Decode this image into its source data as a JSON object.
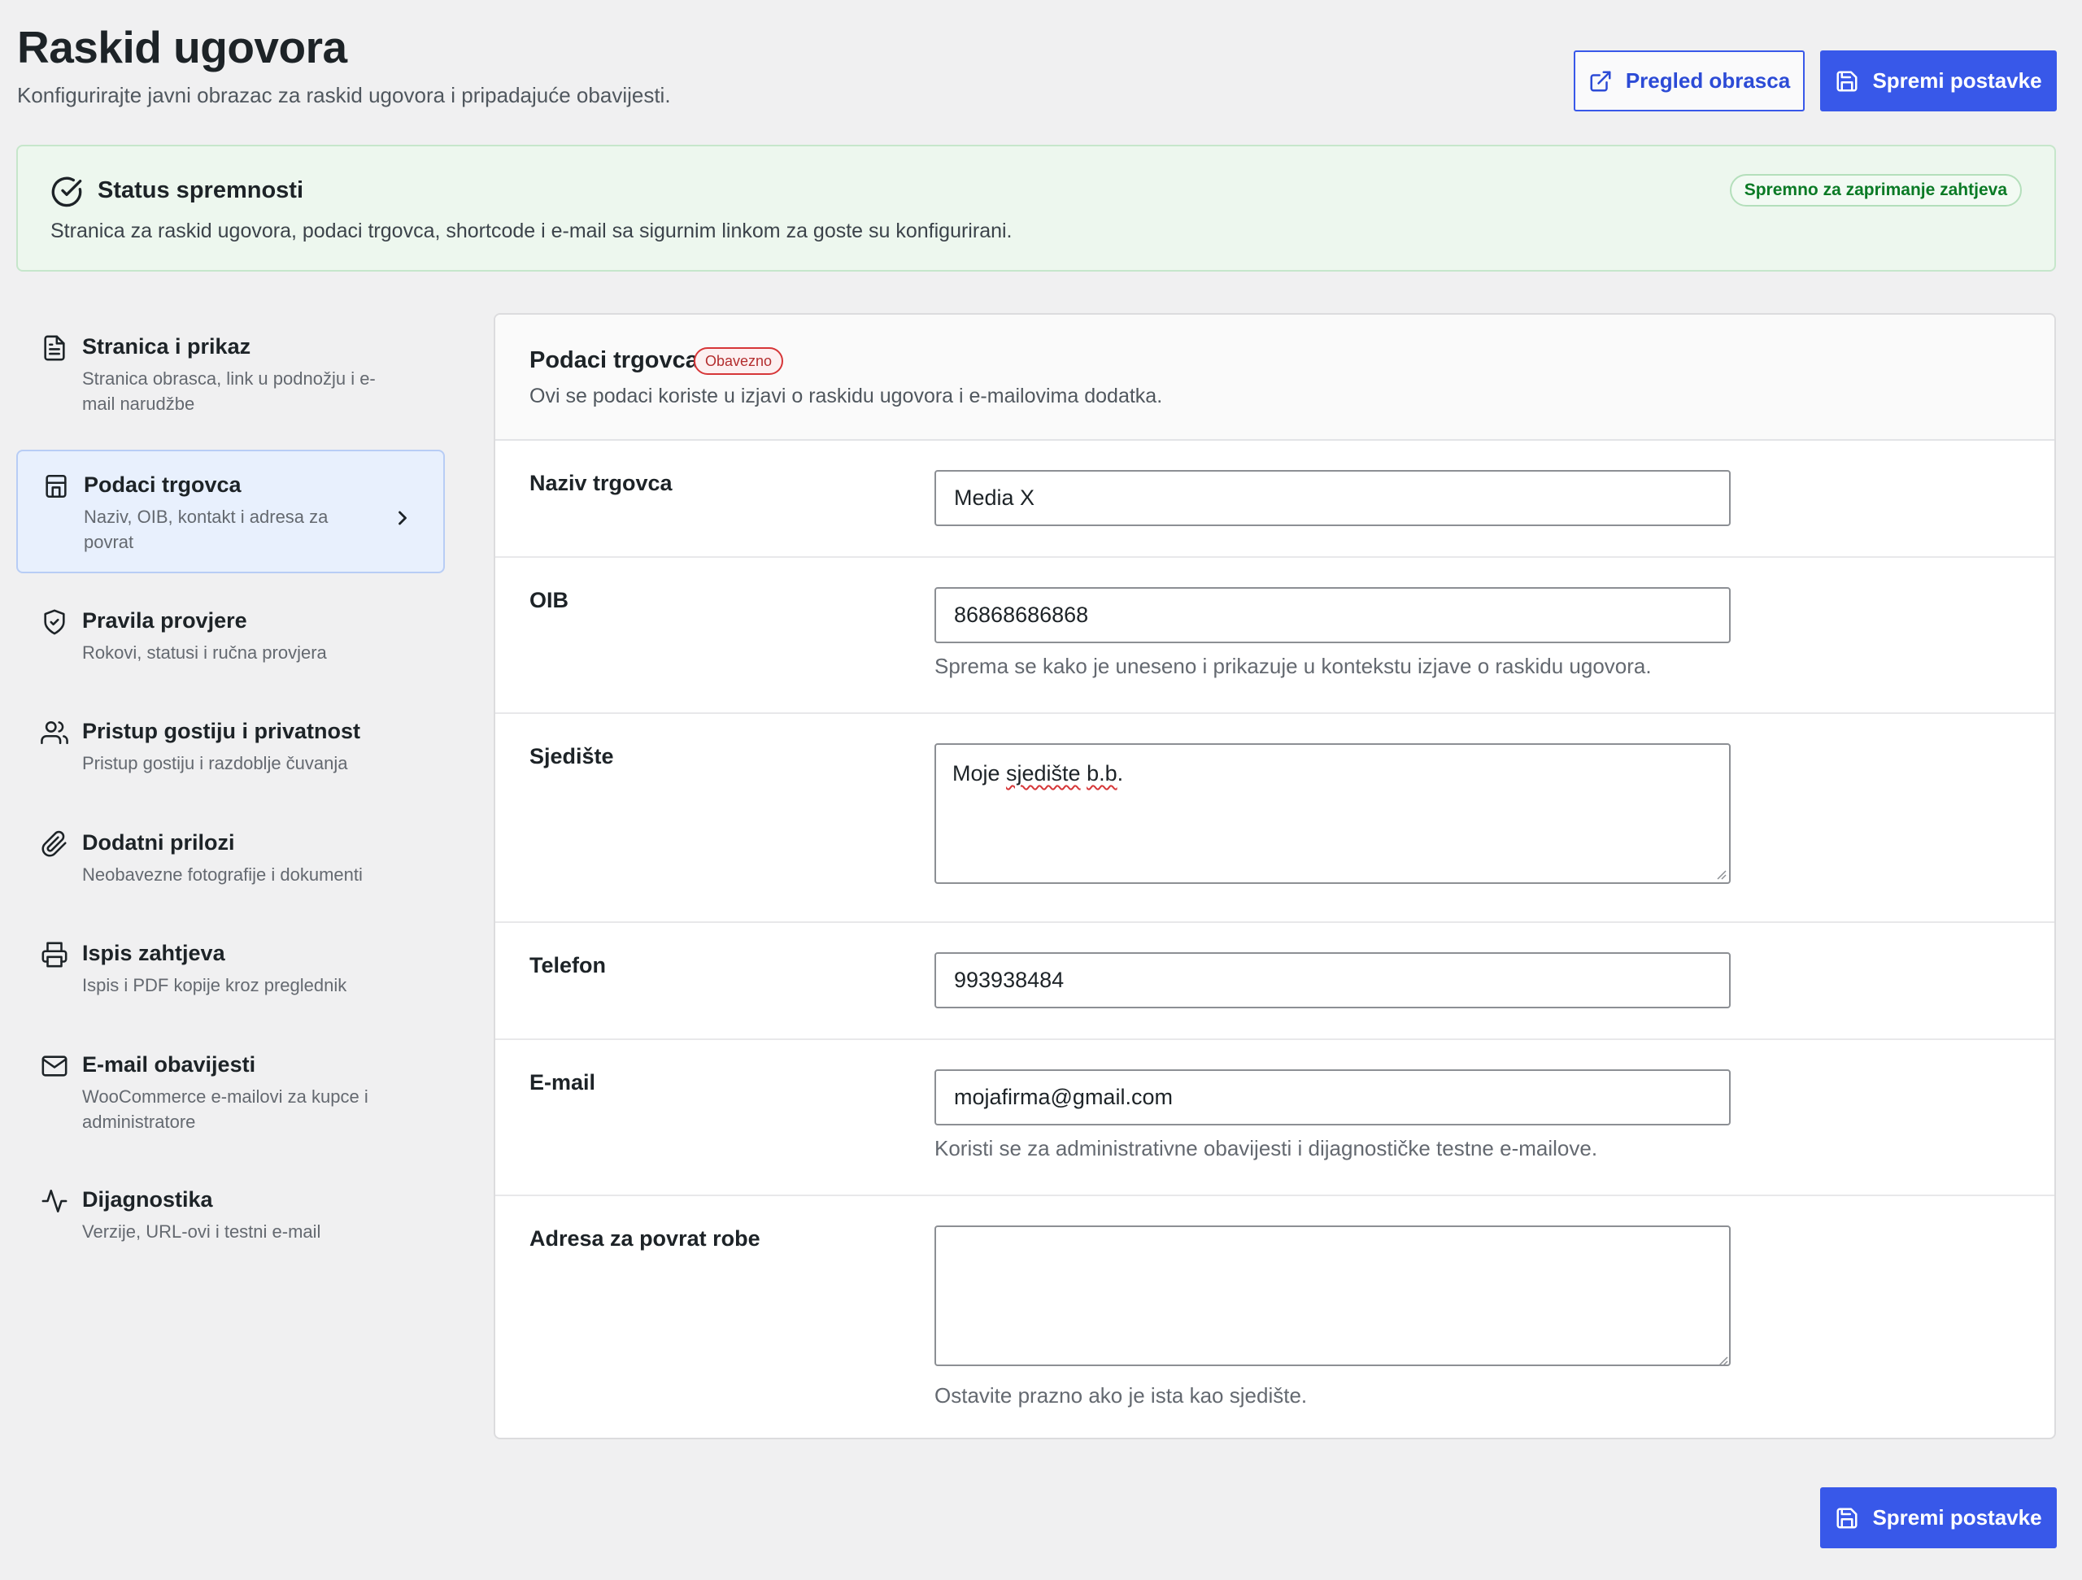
{
  "header": {
    "title": "Raskid ugovora",
    "subtitle": "Konfigurirajte javni obrazac za raskid ugovora i pripadajuće obavijesti.",
    "preview_label": "Pregled obrasca",
    "save_label": "Spremi postavke"
  },
  "status": {
    "title": "Status spremnosti",
    "description": "Stranica za raskid ugovora, podaci trgovca, shortcode i e-mail sa sigurnim linkom za goste su konfigurirani.",
    "badge": "Spremno za zaprimanje zahtjeva"
  },
  "nav": {
    "items": [
      {
        "label": "Stranica i prikaz",
        "desc": "Stranica obrasca, link u podnožju i e-mail narudžbe",
        "icon": "document-icon"
      },
      {
        "label": "Podaci trgovca",
        "desc": "Naziv, OIB, kontakt i adresa za povrat",
        "icon": "store-icon",
        "active": true
      },
      {
        "label": "Pravila provjere",
        "desc": "Rokovi, statusi i ručna provjera",
        "icon": "shield-check-icon"
      },
      {
        "label": "Pristup gostiju i privatnost",
        "desc": "Pristup gostiju i razdoblje čuvanja",
        "icon": "users-icon"
      },
      {
        "label": "Dodatni prilozi",
        "desc": "Neobavezne fotografije i dokumenti",
        "icon": "paperclip-icon"
      },
      {
        "label": "Ispis zahtjeva",
        "desc": "Ispis i PDF kopije kroz preglednik",
        "icon": "printer-icon"
      },
      {
        "label": "E-mail obavijesti",
        "desc": "WooCommerce e-mailovi za kupce i administratore",
        "icon": "mail-icon"
      },
      {
        "label": "Dijagnostika",
        "desc": "Verzije, URL-ovi i testni e-mail",
        "icon": "activity-icon"
      }
    ]
  },
  "panel": {
    "title": "Podaci trgovca",
    "required_badge": "Obavezno",
    "description": "Ovi se podaci koriste u izjavi o raskidu ugovora i e-mailovima dodatka.",
    "fields": {
      "name": {
        "label": "Naziv trgovca",
        "value": "Media X"
      },
      "oib": {
        "label": "OIB",
        "value": "86868686868",
        "hint": "Sprema se kako je uneseno i prikazuje u kontekstu izjave o raskidu ugovora."
      },
      "seat": {
        "label": "Sjedište",
        "value_before": "Moje ",
        "value_misspelled_1": "sjedište",
        "value_space": " ",
        "value_misspelled_2": "b.b",
        "value_after": "."
      },
      "phone": {
        "label": "Telefon",
        "value": "993938484"
      },
      "email": {
        "label": "E-mail",
        "value": "mojafirma@gmail.com",
        "hint": "Koristi se za administrativne obavijesti i dijagnostičke testne e-mailove."
      },
      "return_address": {
        "label": "Adresa za povrat robe",
        "value": "",
        "hint": "Ostavite prazno ako je ista kao sjedište."
      }
    }
  },
  "colors": {
    "accent": "#3858e9",
    "success_bg": "#edf7ee",
    "success_text": "#0a7a25",
    "required": "#d63638"
  }
}
